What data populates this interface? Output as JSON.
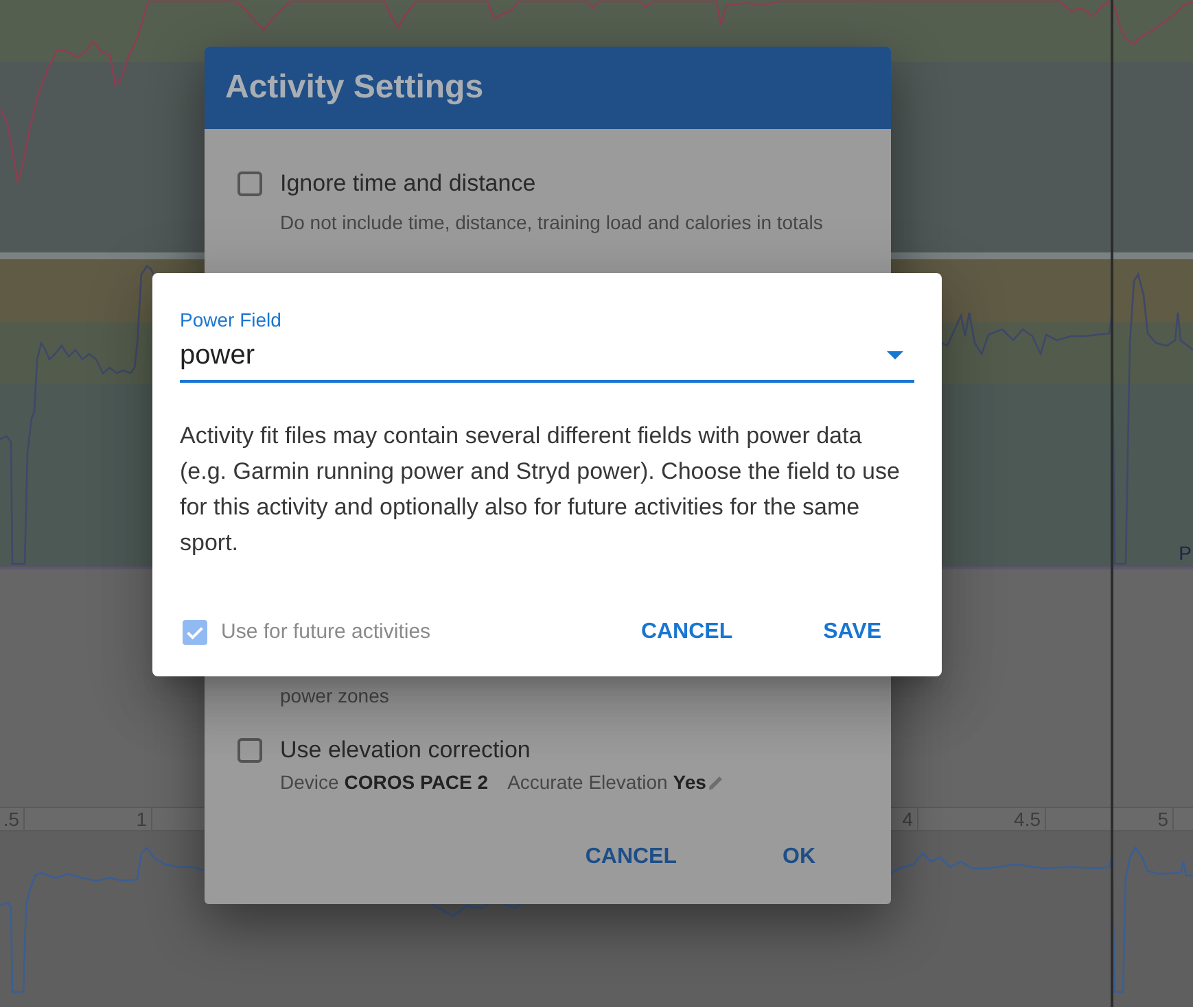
{
  "background": {
    "power_chart": {
      "label": "P"
    },
    "x_axis": {
      "ticks": [
        ".5",
        "1",
        "4",
        "4.5",
        "5"
      ]
    }
  },
  "activity_settings": {
    "title": "Activity Settings",
    "options": [
      {
        "kind": "checkbox",
        "label": "Ignore time and distance",
        "description": "Do not include time, distance, training load and calories in totals",
        "checked": false
      },
      {
        "kind": "continued",
        "description": "power zones"
      },
      {
        "kind": "checkbox",
        "label": "Use elevation correction",
        "checked": false,
        "details": [
          {
            "label": "Device",
            "value": "COROS PACE 2",
            "editable": false
          },
          {
            "label": "Accurate Elevation",
            "value": "Yes",
            "editable": true
          }
        ]
      }
    ],
    "buttons": [
      {
        "label": "CANCEL"
      },
      {
        "label": "OK"
      }
    ]
  },
  "power_field_dialog": {
    "field": {
      "label": "Power Field",
      "value": "power"
    },
    "description": "Activity fit files may contain several different fields with power data (e.g. Garmin running power and Stryd power). Choose the field to use for this activity and optionally also for future activities for the same sport.",
    "remember": {
      "label": "Use for future activities",
      "checked": true,
      "disabled": true
    },
    "buttons": [
      {
        "label": "CANCEL"
      },
      {
        "label": "SAVE"
      }
    ]
  }
}
